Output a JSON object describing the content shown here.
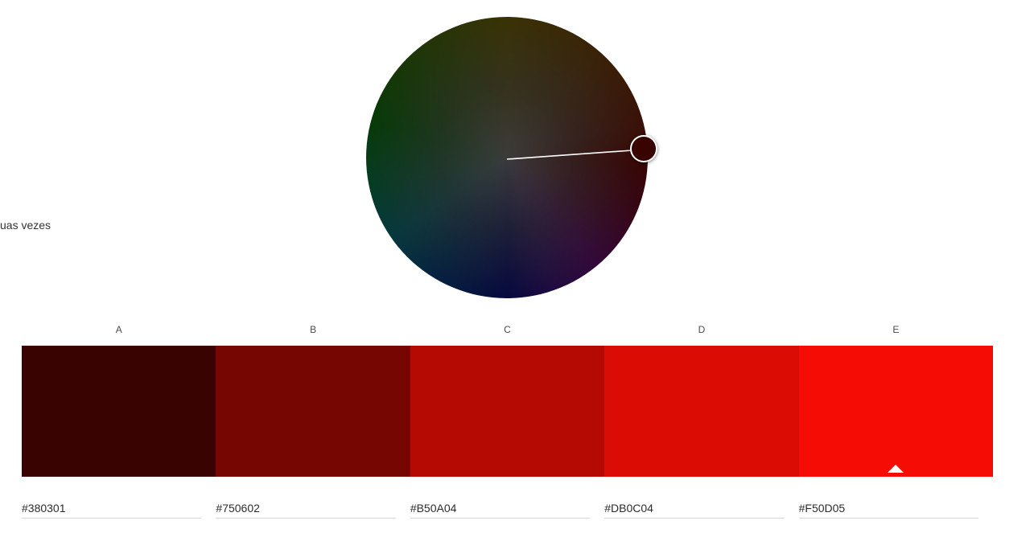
{
  "hint_text": "uas vezes",
  "wheel": {
    "selected_color": "#380301"
  },
  "palette": {
    "swatches": [
      {
        "letter": "A",
        "hex": "#380301",
        "color": "#380301"
      },
      {
        "letter": "B",
        "hex": "#750602",
        "color": "#750602"
      },
      {
        "letter": "C",
        "hex": "#B50A04",
        "color": "#B50A04"
      },
      {
        "letter": "D",
        "hex": "#DB0C04",
        "color": "#DB0C04"
      },
      {
        "letter": "E",
        "hex": "#F50D05",
        "color": "#F50D05"
      }
    ],
    "base_swatch": "E"
  }
}
